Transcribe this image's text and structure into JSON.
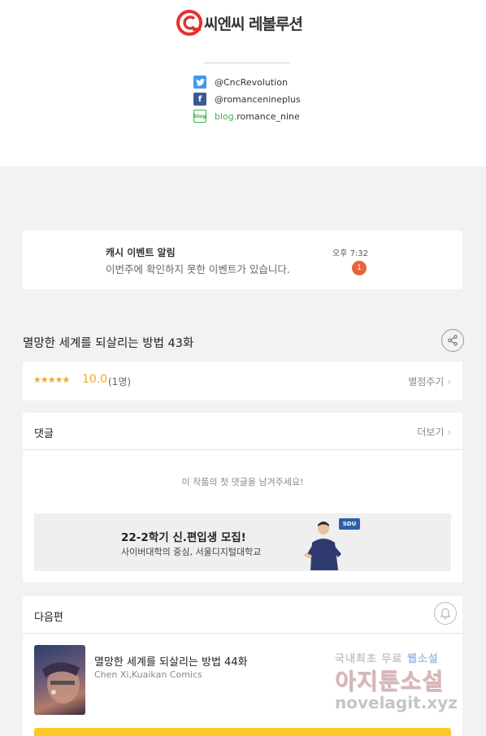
{
  "brand": {
    "name": "씨엔씨 레볼루션",
    "accent": "#e4322b"
  },
  "social": [
    {
      "icon": "twitter-icon",
      "handle": "@CncRevolution"
    },
    {
      "icon": "facebook-icon",
      "handle": "@romancenineplus"
    },
    {
      "icon": "blog-icon",
      "prefix": "blog.",
      "handle": "romance_nine"
    }
  ],
  "notification": {
    "title": "캐시 이벤트 알림",
    "body": "이번주에 확인하지 못한 이벤트가 있습니다.",
    "time": "오후 7:32",
    "badge": "1",
    "badge_color": "#e8633b"
  },
  "episode": {
    "title": "멸망한 세계를 되살리는 방법 43화"
  },
  "rating": {
    "stars": "★★★★★",
    "score": "10.0",
    "count": "(1명)",
    "action": "별점주기"
  },
  "comments": {
    "heading": "댓글",
    "more": "더보기",
    "empty_text": "이 작품의 첫 댓글을 남겨주세요!"
  },
  "ad": {
    "title": "22-2학기 신.편입생 모집!",
    "subtitle": "사이버대학의 중심, 서울디지털대학교",
    "logo": "SDU"
  },
  "next_episode": {
    "heading": "다음편",
    "title": "멸망한 세계를 되살리는 방법 44화",
    "authors": "Chen Xi,Kuaikan Comics"
  },
  "watermark": {
    "line1_a": "국내최초 무료 ",
    "line1_b": "웹소설",
    "line2": "아지툰소설",
    "line3": "novelagit.xyz"
  }
}
